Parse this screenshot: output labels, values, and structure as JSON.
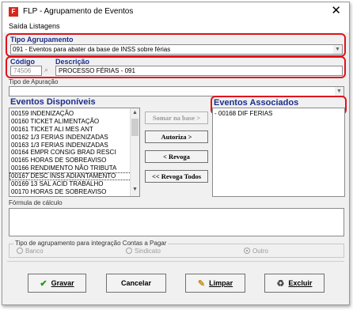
{
  "window": {
    "title": "FLP - Agrupamento de Eventos",
    "close_symbol": "✕"
  },
  "menu": {
    "items": [
      "Saída",
      "Listagens"
    ]
  },
  "tipo_agrupamento": {
    "label": "Tipo Agrupamento",
    "value": "091 - Eventos para abater da base de INSS sobre férias"
  },
  "codigo": {
    "label": "Código",
    "value": "74506"
  },
  "descricao": {
    "label": "Descrição",
    "value": "PROCESSO FÉRIAS - 091"
  },
  "tipo_apuracao": {
    "label": "Tipo de Apuração",
    "value": ""
  },
  "eventos_disponiveis": {
    "label": "Eventos Disponíveis",
    "items": [
      "00159 INDENIZAÇÃO",
      "00160 TICKET ALIMENTAÇÃO",
      "00161 TICKET ALI MES ANT",
      "00162 1/3 FERIAS INDENIZADAS",
      "00163 1/3 FERIAS INDENIZADAS",
      "00164 EMPR CONSIG BRAD RESCI",
      "00165 HORAS DE SOBREAVISO",
      "00166 RENDIMENTO NÃO TRIBUTA",
      "00167 DESC INSS ADIANTAMENTO",
      "00169 13 SAL ACID TRABALHO",
      "00170 HORAS DE SOBREAVISO"
    ]
  },
  "eventos_associados": {
    "label": "Eventos Associados",
    "items": [
      "- 00168 DIF FERIAS"
    ]
  },
  "buttons": {
    "somar": "Somar  na base >",
    "autoriza": "Autoriza >",
    "revoga": "< Revoga",
    "revoga_todos": "<< Revoga Todos"
  },
  "formula": {
    "label": "Fórmula de cálculo",
    "value": ""
  },
  "integracao": {
    "title": "Tipo de agrupamento para integração Contas a Pagar",
    "options": [
      "Banco",
      "Sindicato",
      "Outro"
    ],
    "selected": "Outro"
  },
  "footer": {
    "gravar": "Gravar",
    "cancelar": "Cancelar",
    "limpar": "Limpar",
    "excluir": "Excluir"
  },
  "colors": {
    "highlight_border": "#e0141e",
    "section_label": "#1c2d8a",
    "app_icon": "#d9261c"
  }
}
